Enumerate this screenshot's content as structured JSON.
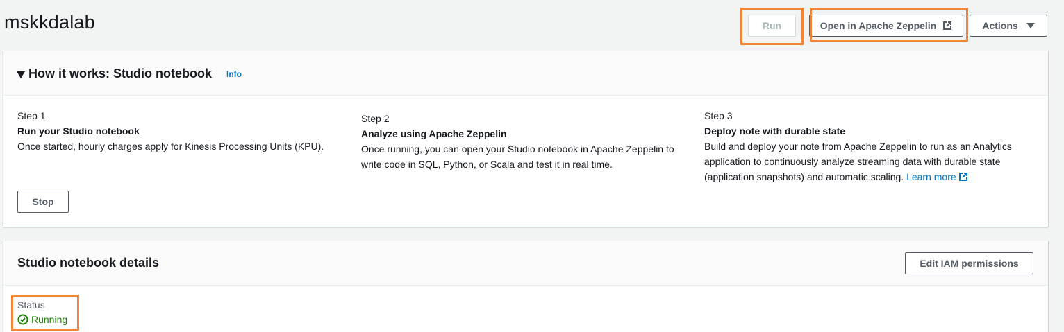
{
  "header": {
    "title": "mskkdalab",
    "run_label": "Run",
    "open_zeppelin_label": "Open in Apache Zeppelin",
    "actions_label": "Actions"
  },
  "how_it_works": {
    "title": "How it works: Studio notebook",
    "info_label": "Info",
    "steps": [
      {
        "number": "Step 1",
        "title": "Run your Studio notebook",
        "description": "Once started, hourly charges apply for Kinesis Processing Units (KPU)."
      },
      {
        "number": "Step 2",
        "title": "Analyze using Apache Zeppelin",
        "description": "Once running, you can open your Studio notebook in Apache Zeppelin to write code in SQL, Python, or Scala and test it in real time."
      },
      {
        "number": "Step 3",
        "title": "Deploy note with durable state",
        "description": "Build and deploy your note from Apache Zeppelin to run as an Analytics application to continuously analyze streaming data with durable state (application snapshots) and automatic scaling.",
        "learn_more_label": "Learn more"
      }
    ],
    "stop_label": "Stop"
  },
  "details": {
    "title": "Studio notebook details",
    "edit_iam_label": "Edit IAM permissions",
    "status_label": "Status",
    "status_value": "Running"
  },
  "icons": {
    "external_link": "external-link-icon",
    "caret_down": "caret-down-icon",
    "expand_caret": "expand-caret-icon",
    "check_circle": "check-circle-icon"
  },
  "colors": {
    "highlight": "#f58536",
    "link": "#0073bb",
    "success": "#1d8102",
    "button_text": "#545b64"
  }
}
